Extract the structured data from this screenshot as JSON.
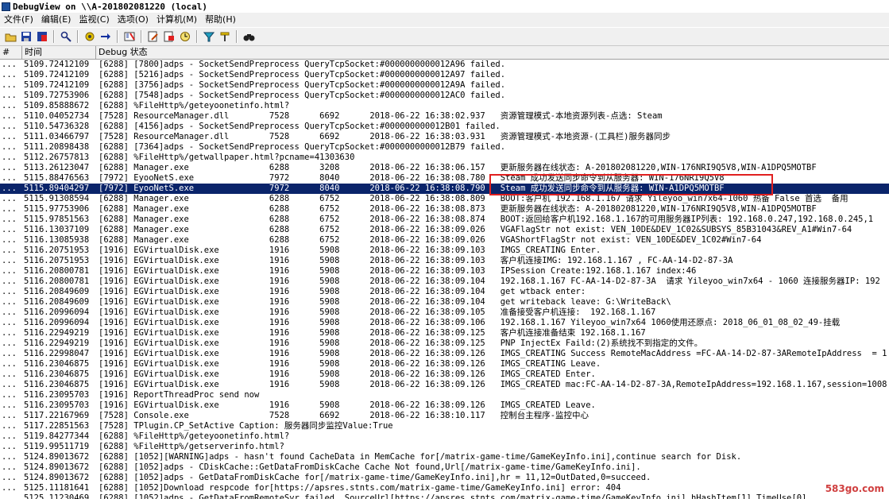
{
  "window": {
    "title": "DebugView on \\\\A-201802081220 (local)"
  },
  "menu": [
    "文件(F)",
    "编辑(E)",
    "监视(C)",
    "选项(O)",
    "计算机(M)",
    "帮助(H)"
  ],
  "toolbar": [
    {
      "icon": "open-folder-icon"
    },
    {
      "icon": "save-icon"
    },
    {
      "icon": "log-to-file-icon"
    },
    {
      "sep": true
    },
    {
      "icon": "find-icon"
    },
    {
      "sep": true
    },
    {
      "icon": "capture-icon"
    },
    {
      "icon": "autoscroll-icon"
    },
    {
      "sep": true
    },
    {
      "icon": "clear-display-icon"
    },
    {
      "sep": true
    },
    {
      "icon": "edit-filter-icon"
    },
    {
      "icon": "highlight-icon"
    },
    {
      "icon": "clock-icon"
    },
    {
      "sep": true
    },
    {
      "icon": "filter-icon"
    },
    {
      "icon": "history-depth-icon"
    },
    {
      "sep": true
    },
    {
      "icon": "binoculars-icon"
    }
  ],
  "columns": {
    "num": "#",
    "time": "时间",
    "debug": "Debug 状态"
  },
  "rows": [
    {
      "t": "5109.72412109",
      "m": "[6288] [7800]adps - SocketSendPreprocess QueryTcpSocket:#0000000000012A96 failed."
    },
    {
      "t": "5109.72412109",
      "m": "[6288] [5216]adps - SocketSendPreprocess QueryTcpSocket:#0000000000012A97 failed."
    },
    {
      "t": "5109.72412109",
      "m": "[6288] [3756]adps - SocketSendPreprocess QueryTcpSocket:#0000000000012A9A failed."
    },
    {
      "t": "5109.72753906",
      "m": "[6288] [7548]adps - SocketSendPreprocess QueryTcpSocket:#0000000000012AC0 failed."
    },
    {
      "t": "5109.85888672",
      "m": "[6288] %FileHttp%/geteyoonetinfo.html?"
    },
    {
      "t": "5110.04052734",
      "m": "[7528] ResourceManager.dll        7528      6692      2018-06-22 16:38:02.937   资源管理模式-本地资源列表-点选: Steam"
    },
    {
      "t": "5110.54736328",
      "m": "[6288] [4156]adps - SocketSendPreprocess QueryTcpSocket:#000000000012B01 failed."
    },
    {
      "t": "5111.03466797",
      "m": "[7528] ResourceManager.dll        7528      6692      2018-06-22 16:38:03.931   资源管理模式-本地资源-(工具栏)服务器同步"
    },
    {
      "t": "5111.20898438",
      "m": "[6288] [7364]adps - SocketSendPreprocess QueryTcpSocket:#0000000000012B79 failed."
    },
    {
      "t": "5112.26757813",
      "m": "[6288] %FileHttp%/getwallpaper.html?pcname=41303630"
    },
    {
      "t": "5113.26123047",
      "m": "[6288] Manager.exe                6288      3208      2018-06-22 16:38:06.157   更新服务器在线状态: A-201802081220,WIN-176NRI9Q5V8,WIN-A1DPQ5MOTBF"
    },
    {
      "t": "5115.88476563",
      "m": "[7972] EyooNetS.exe               7972      8040      2018-06-22 16:38:08.780   Steam 成功发送同步命令到从服务器: WIN-176NRI9Q5V8"
    },
    {
      "t": "5115.89404297",
      "m": "[7972] EyooNetS.exe               7972      8040      2018-06-22 16:38:08.790   Steam 成功发送同步命令到从服务器: WIN-A1DPQ5MOTBF"
    },
    {
      "t": "5115.91308594",
      "m": "[6288] Manager.exe                6288      6752      2018-06-22 16:38:08.809   BOOT:客户机 192.168.1.167 请求 Yileyoo_win7x64-1060 热备 False 首选  备用"
    },
    {
      "t": "5115.97753906",
      "m": "[6288] Manager.exe                6288      6752      2018-06-22 16:38:08.873   更新服务器在线状态: A-201802081220,WIN-176NRI9Q5V8,WIN-A1DPQ5MOTBF"
    },
    {
      "t": "5115.97851563",
      "m": "[6288] Manager.exe                6288      6752      2018-06-22 16:38:08.874   BOOT:返回给客户机192.168.1.167的可用服务器IP列表: 192.168.0.247,192.168.0.245,1"
    },
    {
      "t": "5116.13037109",
      "m": "[6288] Manager.exe                6288      6752      2018-06-22 16:38:09.026   VGAFlagStr not exist: VEN_10DE&DEV_1C02&SUBSYS_85B31043&REV_A1#Win7-64"
    },
    {
      "t": "5116.13085938",
      "m": "[6288] Manager.exe                6288      6752      2018-06-22 16:38:09.026   VGAShortFlagStr not exist: VEN_10DE&DEV_1C02#Win7-64"
    },
    {
      "t": "5116.20751953",
      "m": "[1916] EGVirtualDisk.exe          1916      5908      2018-06-22 16:38:09.103   IMGS_CREATING Enter."
    },
    {
      "t": "5116.20751953",
      "m": "[1916] EGVirtualDisk.exe          1916      5908      2018-06-22 16:38:09.103   客户机连接IMG: 192.168.1.167 , FC-AA-14-D2-87-3A"
    },
    {
      "t": "5116.20800781",
      "m": "[1916] EGVirtualDisk.exe          1916      5908      2018-06-22 16:38:09.103   IPSession Create:192.168.1.167 index:46"
    },
    {
      "t": "5116.20800781",
      "m": "[1916] EGVirtualDisk.exe          1916      5908      2018-06-22 16:38:09.104   192.168.1.167 FC-AA-14-D2-87-3A  请求 Yileyoo_win7x64 - 1060 连接服务器IP: 192"
    },
    {
      "t": "5116.20849609",
      "m": "[1916] EGVirtualDisk.exe          1916      5908      2018-06-22 16:38:09.104   get wtback enter:"
    },
    {
      "t": "5116.20849609",
      "m": "[1916] EGVirtualDisk.exe          1916      5908      2018-06-22 16:38:09.104   get writeback leave: G:\\WriteBack\\"
    },
    {
      "t": "5116.20996094",
      "m": "[1916] EGVirtualDisk.exe          1916      5908      2018-06-22 16:38:09.105   准备接受客户机连接:  192.168.1.167"
    },
    {
      "t": "5116.20996094",
      "m": "[1916] EGVirtualDisk.exe          1916      5908      2018-06-22 16:38:09.106   192.168.1.167 Yileyoo_win7x64 1060使用还原点: 2018_06_01_08_02_49-挂载"
    },
    {
      "t": "5116.22949219",
      "m": "[1916] EGVirtualDisk.exe          1916      5908      2018-06-22 16:38:09.125   客户机连接准备结束 192.168.1.167"
    },
    {
      "t": "5116.22949219",
      "m": "[1916] EGVirtualDisk.exe          1916      5908      2018-06-22 16:38:09.125   PNP InjectEx Faild:(2)系统找不到指定的文件。"
    },
    {
      "t": "5116.22998047",
      "m": "[1916] EGVirtualDisk.exe          1916      5908      2018-06-22 16:38:09.126   IMGS_CREATING Success RemoteMacAddress =FC-AA-14-D2-87-3ARemoteIpAddress  = 1"
    },
    {
      "t": "5116.23046875",
      "m": "[1916] EGVirtualDisk.exe          1916      5908      2018-06-22 16:38:09.126   IMGS_CREATING Leave."
    },
    {
      "t": "5116.23046875",
      "m": "[1916] EGVirtualDisk.exe          1916      5908      2018-06-22 16:38:09.126   IMGS_CREATED Enter."
    },
    {
      "t": "5116.23046875",
      "m": "[1916] EGVirtualDisk.exe          1916      5908      2018-06-22 16:38:09.126   IMGS_CREATED mac:FC-AA-14-D2-87-3A,RemoteIpAddress=192.168.1.167,session=1008"
    },
    {
      "t": "5116.23095703",
      "m": "[1916] ReportThreadProc send now"
    },
    {
      "t": "5116.23095703",
      "m": "[1916] EGVirtualDisk.exe          1916      5908      2018-06-22 16:38:09.126   IMGS_CREATED Leave."
    },
    {
      "t": "5117.22167969",
      "m": "[7528] Console.exe                7528      6692      2018-06-22 16:38:10.117   控制台主程序-监控中心"
    },
    {
      "t": "5117.22851563",
      "m": "[7528] TPlugin.CP_SetActive Caption: 服务器同步监控Value:True"
    },
    {
      "t": "5119.84277344",
      "m": "[6288] %FileHttp%/geteyoonetinfo.html?"
    },
    {
      "t": "5119.99511719",
      "m": "[6288] %FileHttp%/getserverinfo.html?"
    },
    {
      "t": "5124.89013672",
      "m": "[6288] [1052][WARNING]adps - hasn't found CacheData in MemCache for[/matrix-game-time/GameKeyInfo.ini],continue search for Disk."
    },
    {
      "t": "5124.89013672",
      "m": "[6288] [1052]adps - CDiskCache::GetDataFromDiskCache Cache Not found,Url[/matrix-game-time/GameKeyInfo.ini]."
    },
    {
      "t": "5124.89013672",
      "m": "[6288] [1052]adps - GetDataFromDiskCache for[/matrix-game-time/GameKeyInfo.ini],hr = 11,12=OutDated,0=succeed."
    },
    {
      "t": "5125.11181641",
      "m": "[6288] [1052]Download respcode for[https://apsres.stnts.com/matrix-game-time/GameKeyInfo.ini] error: 404"
    },
    {
      "t": "5125.11230469",
      "m": "[6288] [1052]adps - GetDataFromRemoteSvr failed, SourceUrl[https://apsres.stnts.com/matrix-game-time/GameKeyInfo.ini],hHashItem[1],TimeUse[0]"
    }
  ],
  "selected_row": 12,
  "dots": "...",
  "watermark": "583go.com"
}
